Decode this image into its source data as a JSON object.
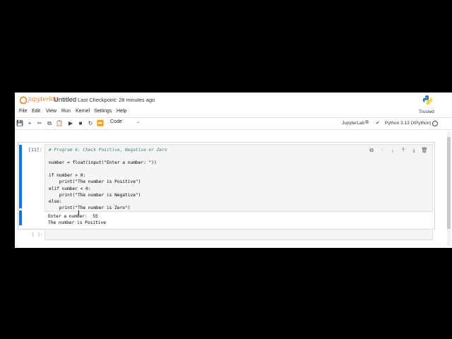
{
  "header": {
    "logo_text": "jupyterlite",
    "title": "Untitled",
    "checkpoint": "Last Checkpoint: 28 minutes ago"
  },
  "menu": [
    "File",
    "Edit",
    "View",
    "Run",
    "Kernel",
    "Settings",
    "Help"
  ],
  "trusted": "Trusted",
  "toolbar": {
    "cell_type": "Code",
    "kernel_link": "JupyterLab",
    "kernel_name": "Python 3.13 (XPython)"
  },
  "cell1": {
    "prompt": "[11]:",
    "code_lines": [
      "# Program 6: Check Positive, Negative or Zero",
      "",
      "number = float(input(\"Enter a number: \"))",
      "",
      "if number > 0:",
      "    print(\"The number is Positive\")",
      "elif number < 0:",
      "    print(\"The number is Negative\")",
      "else:",
      "    print(\"The number is Zero\")"
    ],
    "output_lines": [
      "Enter a number:  55",
      "The number is Positive"
    ]
  },
  "cell2": {
    "prompt": "[ ]:"
  },
  "colors": {
    "accent": "#1976d2",
    "prompt": "#303f9f",
    "logo": "#e07b21"
  }
}
